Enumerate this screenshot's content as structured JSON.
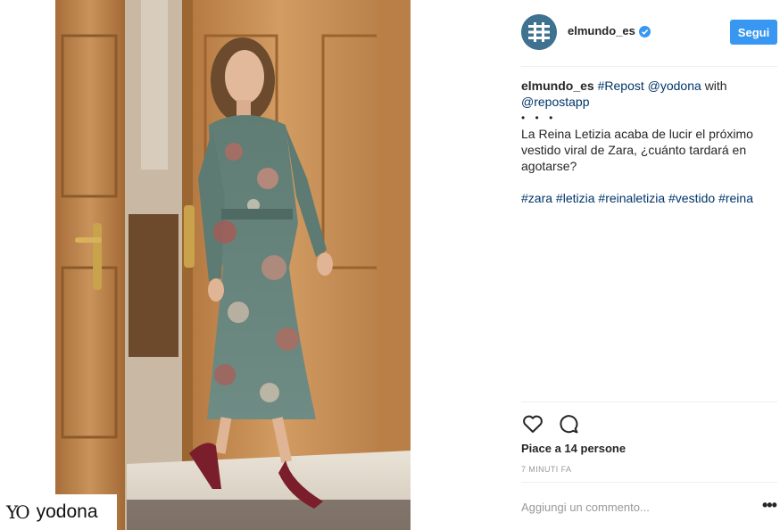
{
  "post": {
    "image_alt": "",
    "watermark": {
      "logo": "YO",
      "text": "yodona"
    }
  },
  "header": {
    "username": "elmundo_es",
    "follow_label": "Segui",
    "verified_icon": "verified-badge-icon",
    "accent_color": "#3897f0"
  },
  "caption": {
    "username": "elmundo_es",
    "repost_tag": "#Repost",
    "mention_1": "@yodona",
    "with_text": "with",
    "mention_2": "@repostapp",
    "dots": "• • •",
    "body": "La Reina Letizia acaba de lucir el próximo vestido viral de Zara, ¿cuánto tardará en agotarse?",
    "hashtags": [
      "#zara",
      "#letizia",
      "#reinaletizia",
      "#vestido",
      "#reina"
    ]
  },
  "actions": {
    "like_icon": "heart-icon",
    "comment_icon": "comment-bubble-icon",
    "likes_text": "Piace a 14 persone",
    "timestamp": "7 MINUTI FA"
  },
  "comment": {
    "placeholder": "Aggiungi un commento...",
    "more_label": "•••"
  }
}
